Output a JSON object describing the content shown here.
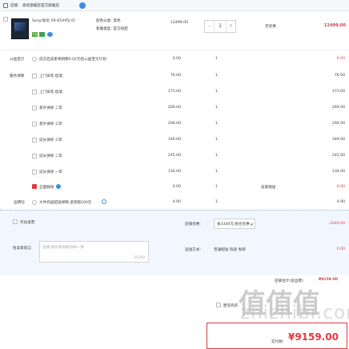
{
  "store": {
    "label": "店铺:",
    "name": "索尼旗舰店官方旗舰店"
  },
  "product": {
    "title": "Sony/索尼 XR-65X95J 65英...",
    "attr1": "颜色分类: 黑色",
    "attr2": "套餐类型: 官方标配",
    "tag": "7天",
    "price": "12499.00",
    "qty": "1",
    "discount": "无优惠",
    "subtotal": "12499.00"
  },
  "gift_row": {
    "label": "公益宝贝",
    "text": "成交后卖家将捐赠0.02元给公益宝贝计划",
    "price": "0.00",
    "qty": "1",
    "subtotal": "0.00"
  },
  "services": [
    {
      "group": "服务保障",
      "label": "上门安装 挂墙",
      "price": "76.00",
      "qty": "1",
      "subtotal": "76.00"
    },
    {
      "group": "",
      "label": "上门安装 挂墙",
      "price": "173.00",
      "qty": "1",
      "subtotal": "173.00"
    },
    {
      "group": "",
      "label": "意外保修 二年",
      "price": "269.00",
      "qty": "1",
      "subtotal": "269.00"
    },
    {
      "group": "",
      "label": "意外保修 三年",
      "price": "294.00",
      "qty": "1",
      "subtotal": "294.00"
    },
    {
      "group": "",
      "label": "延长保修 三年",
      "price": "349.00",
      "qty": "1",
      "subtotal": "349.00"
    },
    {
      "group": "",
      "label": "延长保修 二年",
      "price": "245.00",
      "qty": "1",
      "subtotal": "245.00"
    },
    {
      "group": "",
      "label": "延长保修 一年",
      "price": "134.00",
      "qty": "1",
      "subtotal": "134.00"
    }
  ],
  "insurance_row": {
    "label": "全国联保",
    "price": "0.00",
    "qty": "1",
    "note": "卖家赠送",
    "subtotal": "0.00"
  },
  "freight_row": {
    "label": "运费险",
    "text": "大件商品配送保障,退货赔100元",
    "price": "4.90",
    "qty": "1",
    "subtotal": "4.90"
  },
  "invoice": {
    "label": "开具发票"
  },
  "coupon": {
    "label": "店铺优惠:",
    "selected": "省3340元:组合优惠",
    "amount": "-3340.00"
  },
  "message": {
    "label": "给卖家留言:",
    "placeholder": "选填,请先和商家协商一致",
    "count": "0/200"
  },
  "shipping": {
    "label": "运送方式:",
    "value": "普通配送 快递 免邮",
    "amount": "0.00"
  },
  "total": {
    "label": "店铺合计(含运费)",
    "amount": "¥9159.00"
  },
  "footer": {
    "anon_label": "匿名购买",
    "final_label": "实付款:",
    "final": "¥9159.00"
  },
  "watermark": {
    "text": "zhizhibi.com",
    "glyph": "值值值"
  },
  "colors": {
    "accent": "#e4393c",
    "light_blue": "#f2f7ff",
    "text": "#3c3c3c"
  }
}
